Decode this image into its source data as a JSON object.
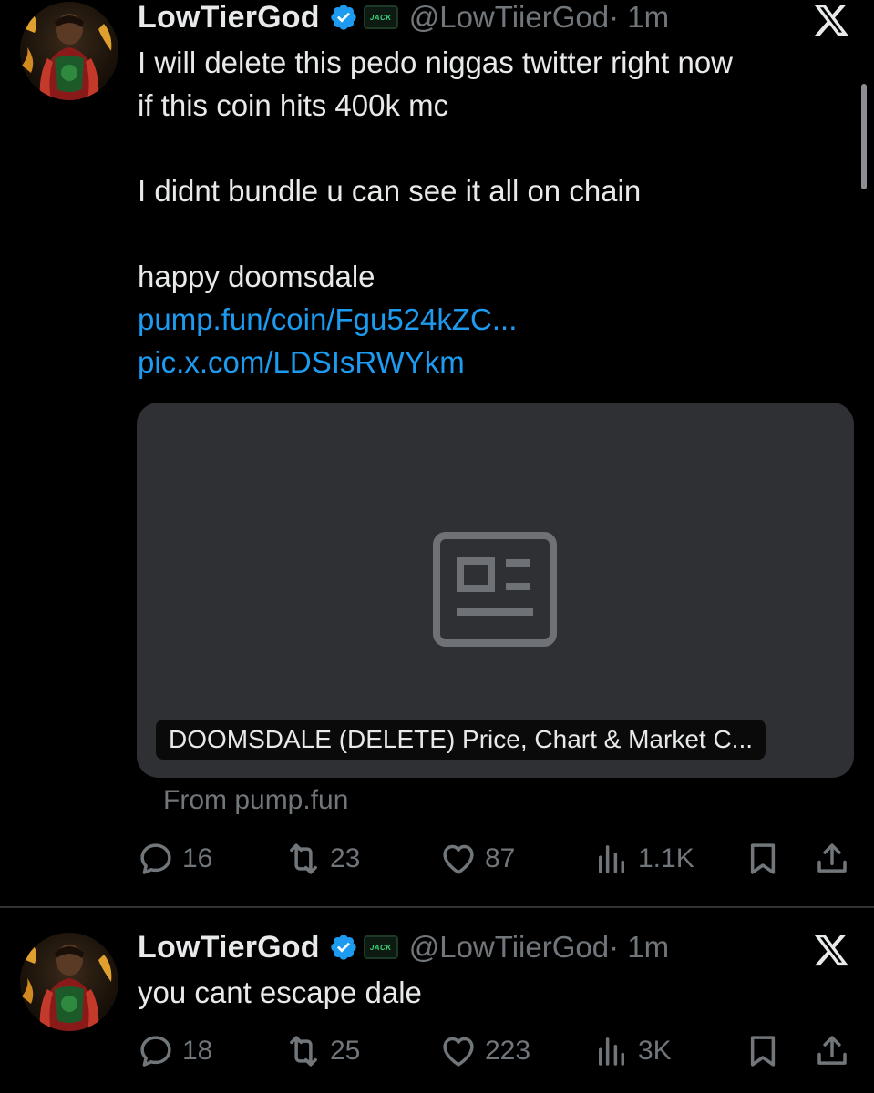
{
  "tweets": [
    {
      "display_name": "LowTierGod",
      "affiliate_badge": "JACK",
      "handle": "@LowTiierGod",
      "time": "· 1m",
      "lines": [
        "I will delete this pedo niggas twitter right now",
        "if this coin hits 400k mc",
        "",
        "I didnt bundle u can see it all on chain",
        "",
        "happy doomsdale"
      ],
      "links": [
        "pump.fun/coin/Fgu524kZC...",
        "pic.x.com/LDSIsRWYkm"
      ],
      "card": {
        "title": "DOOMSDALE (DELETE) Price, Chart & Market C...",
        "source": "From pump.fun",
        "icon": "article-icon"
      },
      "stats": {
        "replies": "16",
        "retweets": "23",
        "likes": "87",
        "views": "1.1K"
      }
    },
    {
      "display_name": "LowTierGod",
      "affiliate_badge": "JACK",
      "handle": "@LowTiierGod",
      "time": "· 1m",
      "lines": [
        "you cant escape dale"
      ],
      "stats": {
        "replies": "18",
        "retweets": "25",
        "likes": "223",
        "views": "3K"
      }
    }
  ],
  "colors": {
    "background": "#000000",
    "text": "#e7e9ea",
    "secondary": "#71767b",
    "link": "#1d9bf0",
    "verified": "#1d9bf0",
    "card_bg": "#2f3033"
  }
}
